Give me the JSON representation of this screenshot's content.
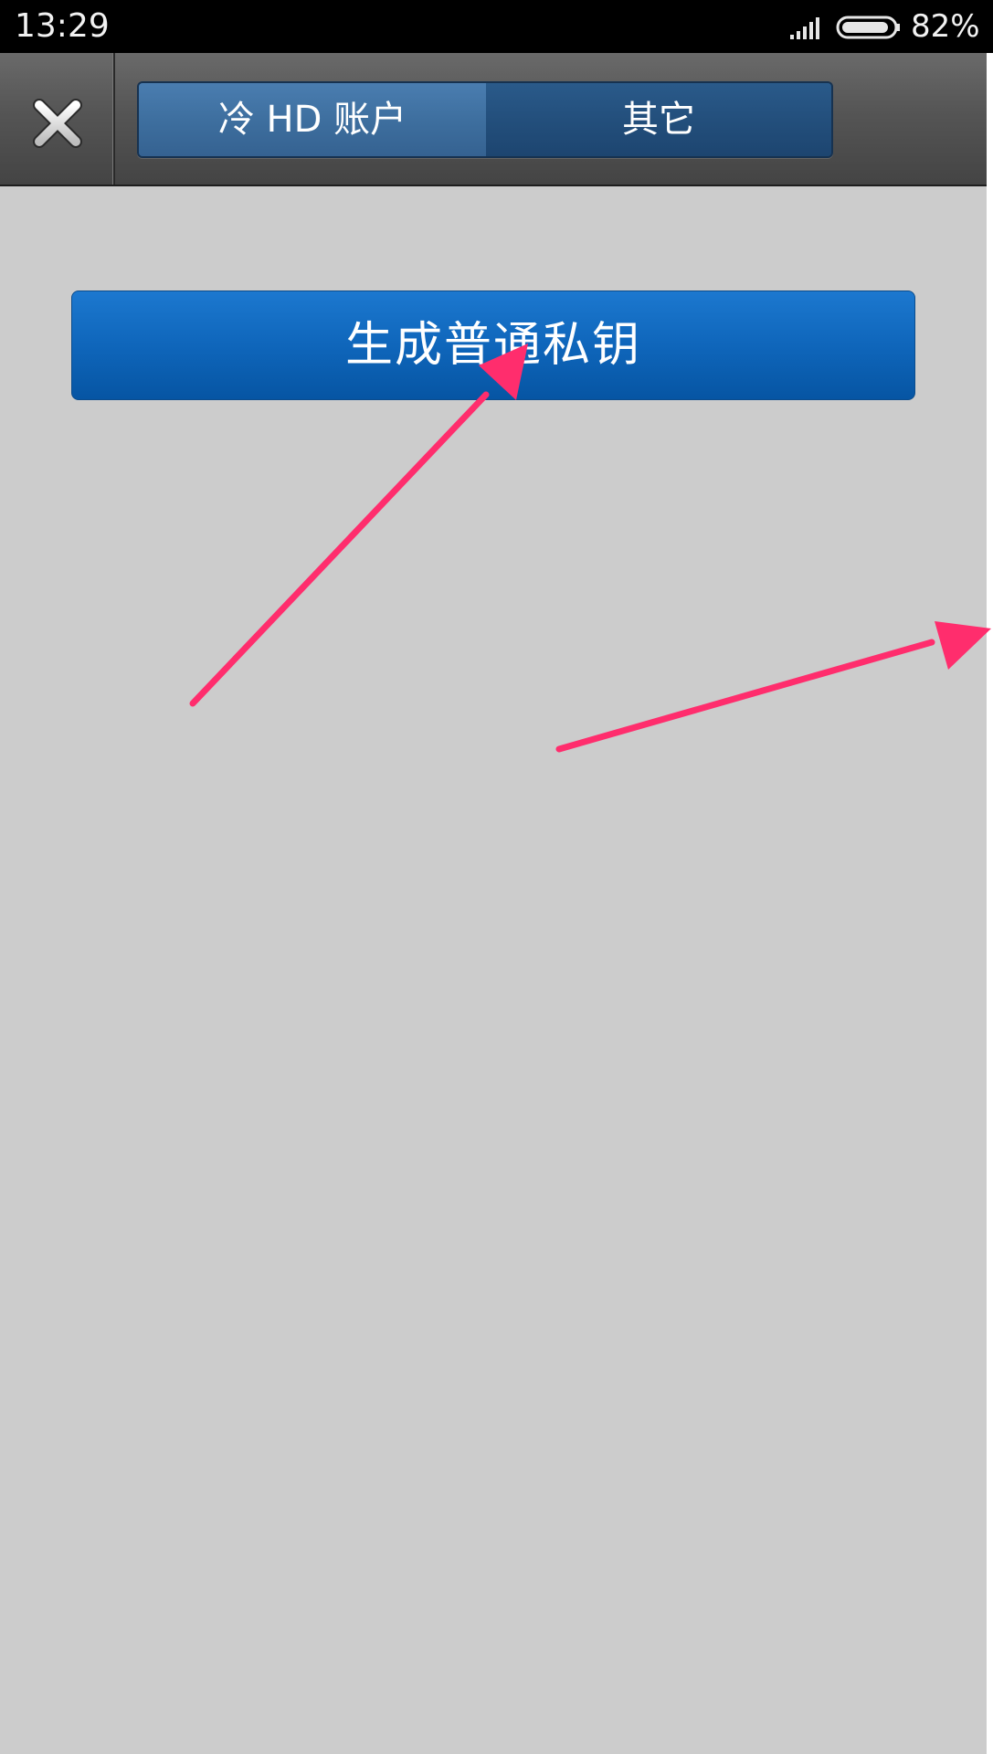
{
  "status_bar": {
    "time": "13:29",
    "battery": "82%",
    "signal_icon": "signal-bars-icon",
    "battery_icon": "battery-icon"
  },
  "toolbar": {
    "close_icon": "close-icon",
    "tabs": [
      {
        "label": "冷 HD 账户",
        "selected": true
      },
      {
        "label": "其它",
        "selected": false
      }
    ]
  },
  "main": {
    "primary_button_label": "生成普通私钥"
  },
  "annotations": {
    "arrow_color": "#ff2d6d"
  },
  "colors": {
    "background": "#cccccc",
    "button": "#0f66bb",
    "tab_selected": "#3e6f9f",
    "tab_unselected": "#234f7c"
  }
}
